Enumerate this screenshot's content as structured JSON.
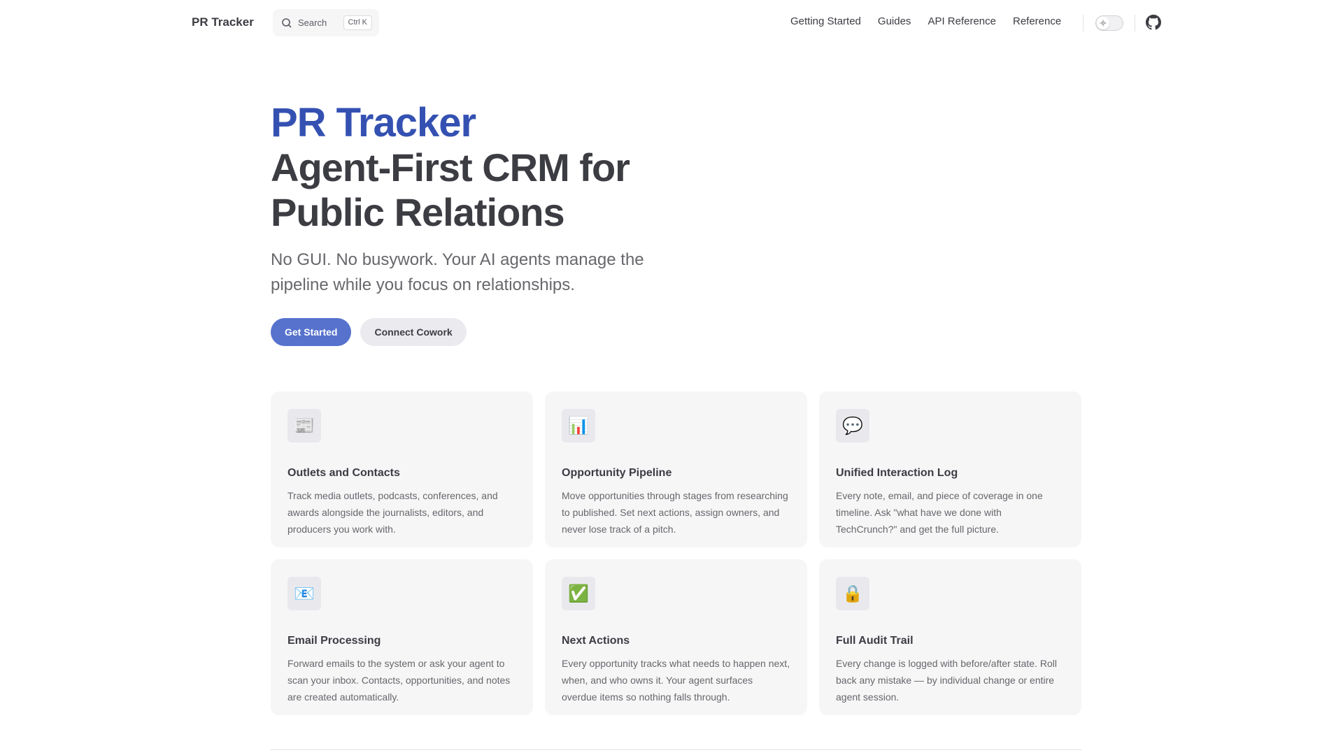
{
  "nav": {
    "brand": "PR Tracker",
    "search_label": "Search",
    "search_shortcut": "Ctrl K",
    "links": [
      "Getting Started",
      "Guides",
      "API Reference",
      "Reference"
    ]
  },
  "hero": {
    "name": "PR Tracker",
    "text_line1": "Agent-First CRM for",
    "text_line2": "Public Relations",
    "tagline": "No GUI. No busywork. Your AI agents manage the pipeline while you focus on relationships.",
    "primary_action": "Get Started",
    "secondary_action": "Connect Cowork"
  },
  "features": [
    {
      "icon": "📰",
      "icon_name": "newspaper-icon",
      "title": "Outlets and Contacts",
      "details": "Track media outlets, podcasts, conferences, and awards alongside the journalists, editors, and producers you work with."
    },
    {
      "icon": "📊",
      "icon_name": "bar-chart-icon",
      "title": "Opportunity Pipeline",
      "details": "Move opportunities through stages from researching to published. Set next actions, assign owners, and never lose track of a pitch."
    },
    {
      "icon": "💬",
      "icon_name": "speech-bubble-icon",
      "title": "Unified Interaction Log",
      "details": "Every note, email, and piece of coverage in one timeline. Ask \"what have we done with TechCrunch?\" and get the full picture."
    },
    {
      "icon": "📧",
      "icon_name": "email-icon",
      "title": "Email Processing",
      "details": "Forward emails to the system or ask your agent to scan your inbox. Contacts, opportunities, and notes are created automatically."
    },
    {
      "icon": "✅",
      "icon_name": "check-mark-icon",
      "title": "Next Actions",
      "details": "Every opportunity tracks what needs to happen next, when, and who owns it. Your agent surfaces overdue items so nothing falls through."
    },
    {
      "icon": "🔒",
      "icon_name": "lock-icon",
      "title": "Full Audit Trail",
      "details": "Every change is logged with before/after state. Roll back any mistake — by individual change or entire agent session."
    }
  ],
  "colors": {
    "brand": "#3451b2",
    "button_brand": "#5672cd",
    "text": "#3c3c43",
    "muted": "#67676c",
    "card_bg": "#f6f6f7"
  }
}
